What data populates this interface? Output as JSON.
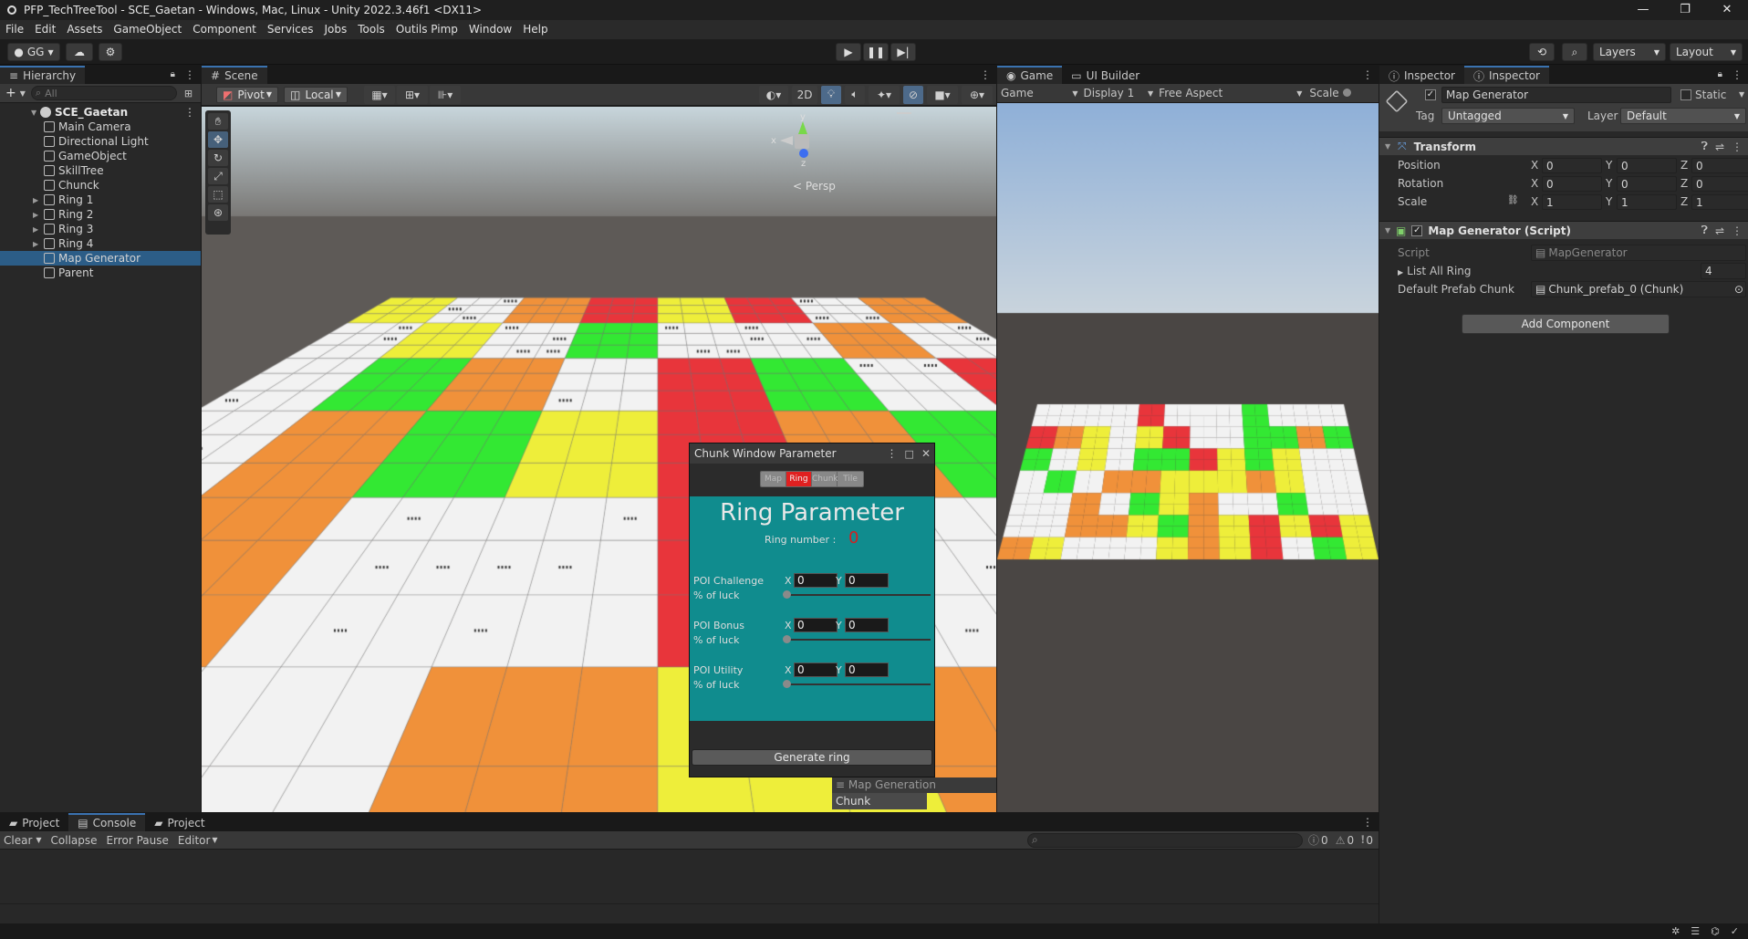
{
  "window": {
    "title": "PFP_TechTreeTool - SCE_Gaetan - Windows, Mac, Linux - Unity 2022.3.46f1 <DX11>"
  },
  "menu": [
    "File",
    "Edit",
    "Assets",
    "GameObject",
    "Component",
    "Services",
    "Jobs",
    "Tools",
    "Outils Pimp",
    "Window",
    "Help"
  ],
  "toolbar": {
    "account": "GG",
    "layers": "Layers",
    "layout": "Layout"
  },
  "hierarchy": {
    "tab": "Hierarchy",
    "search_placeholder": "All",
    "scene": "SCE_Gaetan",
    "items": [
      {
        "label": "Main Camera",
        "foldout": false,
        "selected": false
      },
      {
        "label": "Directional Light",
        "foldout": false,
        "selected": false
      },
      {
        "label": "GameObject",
        "foldout": false,
        "selected": false
      },
      {
        "label": "SkillTree",
        "foldout": false,
        "selected": false
      },
      {
        "label": "Chunck",
        "foldout": false,
        "selected": false
      },
      {
        "label": "Ring 1",
        "foldout": true,
        "selected": false
      },
      {
        "label": "Ring 2",
        "foldout": true,
        "selected": false
      },
      {
        "label": "Ring 3",
        "foldout": true,
        "selected": false
      },
      {
        "label": "Ring 4",
        "foldout": true,
        "selected": false
      },
      {
        "label": "Map Generator",
        "foldout": false,
        "selected": true
      },
      {
        "label": "Parent",
        "foldout": false,
        "selected": false
      }
    ]
  },
  "scene": {
    "tab": "Scene",
    "pivot": "Pivot",
    "local": "Local",
    "mode2d": "2D",
    "persp": "< Persp",
    "gizmo_x": "x",
    "gizmo_y": "y",
    "gizmo_z": "z"
  },
  "game": {
    "tab": "Game",
    "tab2": "UI Builder",
    "mode": "Game",
    "display": "Display 1",
    "aspect": "Free Aspect",
    "scale": "Scale"
  },
  "chunk_window": {
    "title": "Chunk Window Parameter",
    "tabs": [
      "Map",
      "Ring",
      "Chunk",
      "Tile"
    ],
    "active_tab": "Ring",
    "heading": "Ring Parameter",
    "ring_number_label": "Ring number :",
    "ring_number_value": "0",
    "groups": [
      {
        "label": "POI Challenge",
        "x": "0",
        "y": "0",
        "luck": "% of luck"
      },
      {
        "label": "POI Bonus",
        "x": "0",
        "y": "0",
        "luck": "% of luck"
      },
      {
        "label": "POI Utility",
        "x": "0",
        "y": "0",
        "luck": "% of luck"
      }
    ],
    "x_label": "X",
    "y_label": "Y",
    "generate_button": "Generate ring",
    "dock_tab1": "Map Generation Parameter",
    "dock_tab2": "Chunk Parameter"
  },
  "inspector": {
    "tab1": "Inspector",
    "tab2": "Inspector",
    "object_name": "Map Generator",
    "static_label": "Static",
    "tag_label": "Tag",
    "tag_value": "Untagged",
    "layer_label": "Layer",
    "layer_value": "Default",
    "transform_title": "Transform",
    "position_label": "Position",
    "rotation_label": "Rotation",
    "scale_label": "Scale",
    "position": {
      "x": "0",
      "y": "0",
      "z": "0"
    },
    "rotation": {
      "x": "0",
      "y": "0",
      "z": "0"
    },
    "scale": {
      "x": "1",
      "y": "1",
      "z": "1"
    },
    "axis_x": "X",
    "axis_y": "Y",
    "axis_z": "Z",
    "script_component": "Map Generator (Script)",
    "script_label": "Script",
    "script_value": "MapGenerator",
    "list_label": "List All Ring",
    "list_count": "4",
    "prefab_label": "Default Prefab Chunk",
    "prefab_value": "Chunk_prefab_0 (Chunk)",
    "add_component": "Add Component"
  },
  "bottom": {
    "tab1": "Project",
    "tab2": "Console",
    "tab3": "Project",
    "clear": "Clear",
    "collapse": "Collapse",
    "error_pause": "Error Pause",
    "editor": "Editor",
    "count_log": "0",
    "count_warn": "0",
    "count_err": "0"
  },
  "colors": {
    "selection": "#2c5d87",
    "teal_panel": "#108c8e",
    "ring_tab_active": "#e02020",
    "ring_number": "#d42020",
    "tile_red": "#e8353b",
    "tile_orange": "#f0913a",
    "tile_yellow": "#eeee3a",
    "tile_green": "#33e833",
    "tile_white": "#f2f2f2"
  }
}
